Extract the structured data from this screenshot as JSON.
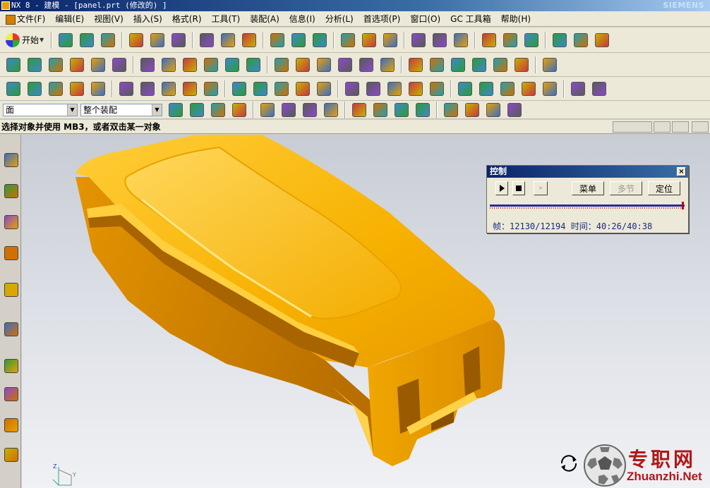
{
  "window": {
    "title": "NX 8 - 建模 - [panel.prt (修改的) ]",
    "brand": "SIEMENS"
  },
  "menubar": {
    "items": [
      "文件(F)",
      "编辑(E)",
      "视图(V)",
      "插入(S)",
      "格式(R)",
      "工具(T)",
      "装配(A)",
      "信息(I)",
      "分析(L)",
      "首选项(P)",
      "窗口(O)",
      "GC 工具箱",
      "帮助(H)"
    ]
  },
  "toolbar": {
    "start_label": "开始",
    "select_filter": "面",
    "select_scope": "整个装配"
  },
  "cue_line": {
    "text": "选择对象并使用 MB3，或者双击某一对象"
  },
  "control_dialog": {
    "title": "控制",
    "close_glyph": "×",
    "menu_button": "菜单",
    "multi_step_button": "多节",
    "locate_button": "定位",
    "ff_glyph": "»",
    "frame_label": "帧：",
    "frame_value": "12130/12194",
    "time_label": "时间：",
    "time_value": "40:26/40:38",
    "progress": 0.995
  },
  "watermark": {
    "cn": "专职网",
    "en": "Zhuanzhi.Net"
  },
  "colors": {
    "part_base": "#f2a900",
    "part_light": "#ffd24a",
    "part_dark": "#c27a00",
    "part_shadow": "#8a5200",
    "dialog_title": "#0a246a",
    "watermark": "#b01818"
  },
  "icons": {
    "toolbar1": [
      "new-file-icon",
      "open-folder-icon",
      "save-icon",
      "cut-icon",
      "copy-icon",
      "paste-icon",
      "undo-icon",
      "fit-view-icon",
      "render-style-icon",
      "cube-view-icon",
      "edge-display-icon",
      "section-view-icon",
      "shaded-box-icon",
      "color-box-icon",
      "background-icon",
      "assembly-icon",
      "reference-icon",
      "layer-icon",
      "wcs-icon",
      "measure-icon",
      "analysis-icon",
      "motion-icon",
      "ruler-icon",
      "drafting-icon"
    ],
    "toolbar2": [
      "sketch-icon",
      "extrude-icon",
      "revolve-icon",
      "block-icon",
      "hole-icon",
      "boss-icon",
      "pattern-icon",
      "mirror-icon",
      "datum-icon",
      "blend-icon",
      "chamfer-icon",
      "shell-icon",
      "draft-icon",
      "trim-icon",
      "split-icon",
      "sew-icon",
      "surface-icon",
      "mesh-icon",
      "thicken-icon",
      "offset-icon",
      "unite-icon",
      "subtract-icon",
      "intersect-icon",
      "studio-surface-icon",
      "n-sided-icon"
    ],
    "toolbar3": [
      "view-icon",
      "layers-icon",
      "stack-icon",
      "label-icon",
      "feature-icon",
      "sync-icon",
      "move-face-icon",
      "replace-face-icon",
      "annotation-icon",
      "gs-icon",
      "os-icon",
      "gh-icon",
      "oh-icon",
      "dimension-icon",
      "cylinder-icon",
      "spring-icon",
      "tools-icon",
      "check-icon",
      "positions-icon",
      "grid-icon",
      "axis-icon",
      "first-frame-icon",
      "prev-frame-icon",
      "next-frame-icon",
      "last-frame-icon",
      "camera-icon",
      "magic-icon"
    ],
    "toolbar4": [
      "selection-intent-icon",
      "filter-icon",
      "snap-icon",
      "face-icon",
      "body-icon",
      "edge-icon",
      "point-icon",
      "endpoint-icon",
      "midpoint-icon",
      "center-icon",
      "quadrant-icon",
      "intersection-icon",
      "line-icon",
      "tangent-icon",
      "curve-icon",
      "box-icon"
    ],
    "resource_bar": [
      "assembly-navigator-icon",
      "constraint-navigator-icon",
      "part-navigator-icon",
      "reuse-library-icon",
      "web-browser-icon",
      "history-icon",
      "clock-icon",
      "system-materials-icon",
      "roles-icon",
      "palette-icon"
    ]
  }
}
